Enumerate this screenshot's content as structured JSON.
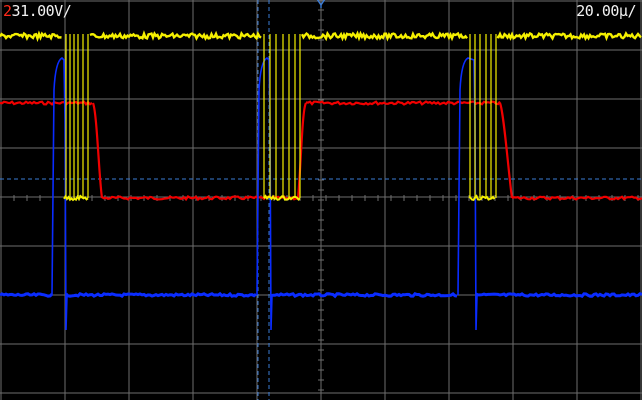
{
  "readouts": {
    "channel_a": "2",
    "channel_b": "3",
    "volts_per_div": "1.00V/",
    "time_per_div": "20.00µ/"
  },
  "colors": {
    "background": "#000000",
    "grid": "#6e6e6e",
    "trace_yellow": "#f5f000",
    "trace_red": "#f00000",
    "trace_blue": "#0a2cff",
    "cursor": "#3a7bd5"
  },
  "icons": {
    "trigger_position": "trigger-arrow-icon"
  }
}
